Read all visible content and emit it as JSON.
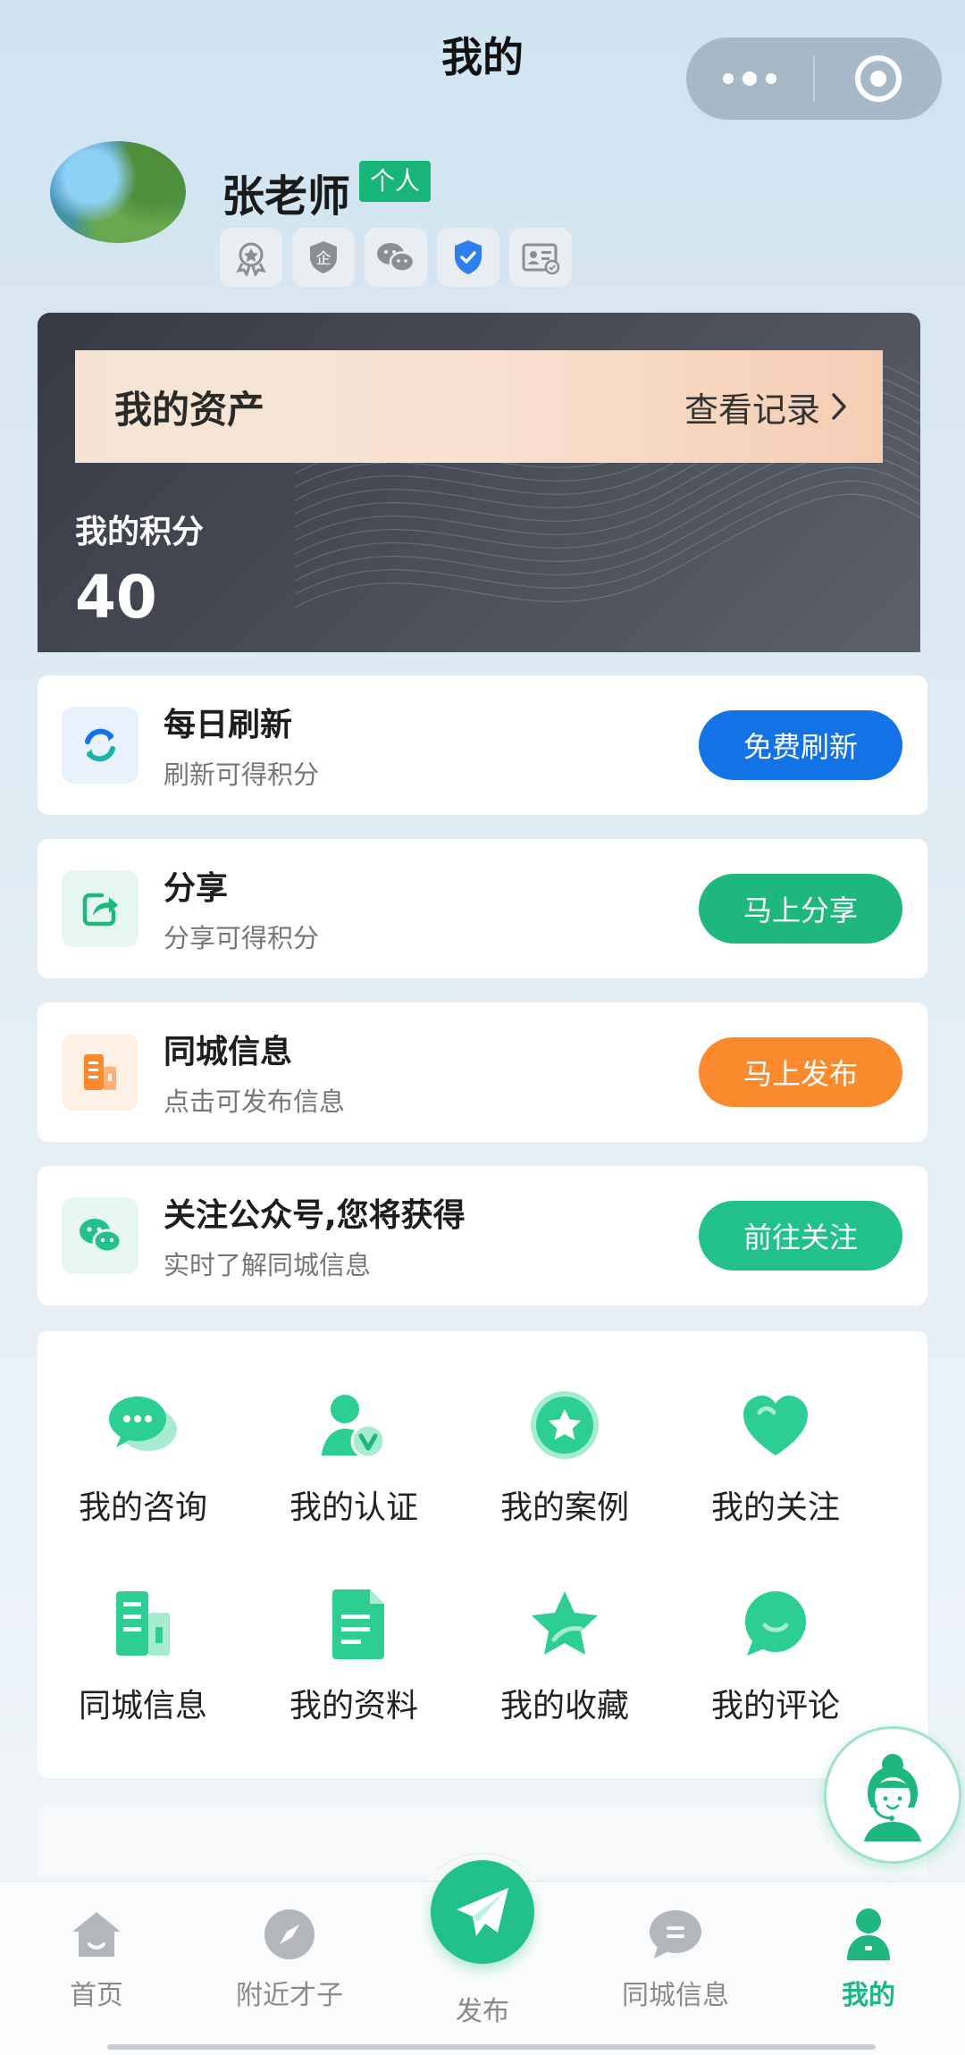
{
  "page": {
    "title": "我的"
  },
  "profile": {
    "name": "张老师",
    "role_tag": "个人",
    "badges": [
      "star-badge-icon",
      "enterprise-badge-icon",
      "wechat-badge-icon",
      "shield-badge-icon",
      "id-card-badge-icon"
    ]
  },
  "assets": {
    "title": "我的资产",
    "view_records": "查看记录",
    "points_label": "我的积分",
    "points_value": "40"
  },
  "tasks": [
    {
      "title": "每日刷新",
      "subtitle": "刷新可得积分",
      "button": "免费刷新",
      "icon": "refresh-icon",
      "color": "#1372e6",
      "icon_bg": "#e8f2fd"
    },
    {
      "title": "分享",
      "subtitle": "分享可得积分",
      "button": "马上分享",
      "icon": "share-icon",
      "color": "#1fb780",
      "icon_bg": "#e6f7f0"
    },
    {
      "title": "同城信息",
      "subtitle": "点击可发布信息",
      "button": "马上发布",
      "icon": "building-icon",
      "color": "#fb8a2e",
      "icon_bg": "#fff0e6"
    },
    {
      "title": "关注公众号,您将获得",
      "subtitle": "实时了解同城信息",
      "button": "前往关注",
      "icon": "wechat-icon",
      "color": "#22c08a",
      "icon_bg": "#e6f7f0"
    }
  ],
  "menu": [
    {
      "label": "我的咨询",
      "icon": "chat-bubbles-icon"
    },
    {
      "label": "我的认证",
      "icon": "user-verified-icon"
    },
    {
      "label": "我的案例",
      "icon": "star-circle-icon"
    },
    {
      "label": "我的关注",
      "icon": "heart-icon"
    },
    {
      "label": "同城信息",
      "icon": "building-icon"
    },
    {
      "label": "我的资料",
      "icon": "document-icon"
    },
    {
      "label": "我的收藏",
      "icon": "star-icon"
    },
    {
      "label": "我的评论",
      "icon": "comment-icon"
    }
  ],
  "nav": {
    "items": [
      {
        "label": "首页",
        "icon": "home-icon"
      },
      {
        "label": "附近才子",
        "icon": "compass-icon"
      },
      {
        "label": "发布",
        "icon": "paper-plane-icon"
      },
      {
        "label": "同城信息",
        "icon": "message-icon"
      },
      {
        "label": "我的",
        "icon": "person-icon",
        "active": true
      }
    ],
    "active_color": "#1fb780"
  },
  "colors": {
    "green": "#1fb780",
    "blue": "#1372e6",
    "orange": "#fb8a2e"
  }
}
